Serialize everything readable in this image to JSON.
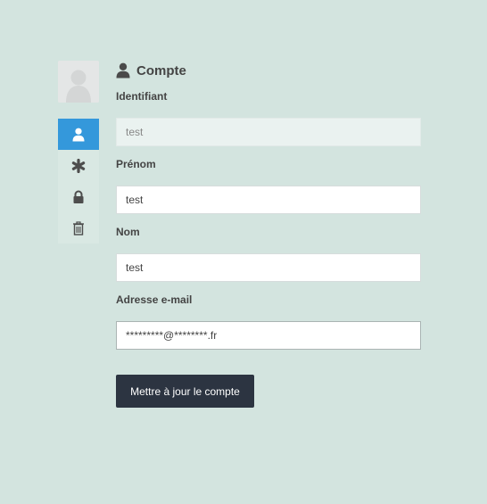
{
  "section": {
    "title": "Compte",
    "icon": "user-icon"
  },
  "sidebar": {
    "avatar": "avatar-placeholder",
    "items": [
      {
        "name": "account",
        "icon": "user-icon",
        "active": true
      },
      {
        "name": "password",
        "icon": "asterisk-icon",
        "active": false
      },
      {
        "name": "security",
        "icon": "lock-icon",
        "active": false
      },
      {
        "name": "delete",
        "icon": "trash-icon",
        "active": false
      }
    ]
  },
  "form": {
    "identifiant": {
      "label": "Identifiant",
      "value": "test"
    },
    "prenom": {
      "label": "Prénom",
      "value": "test"
    },
    "nom": {
      "label": "Nom",
      "value": "test"
    },
    "email": {
      "label": "Adresse e-mail",
      "value": "*********@********.fr"
    },
    "submit_label": "Mettre à jour le compte"
  },
  "colors": {
    "background": "#d3e4df",
    "accent": "#3498db",
    "button": "#2c3441"
  }
}
